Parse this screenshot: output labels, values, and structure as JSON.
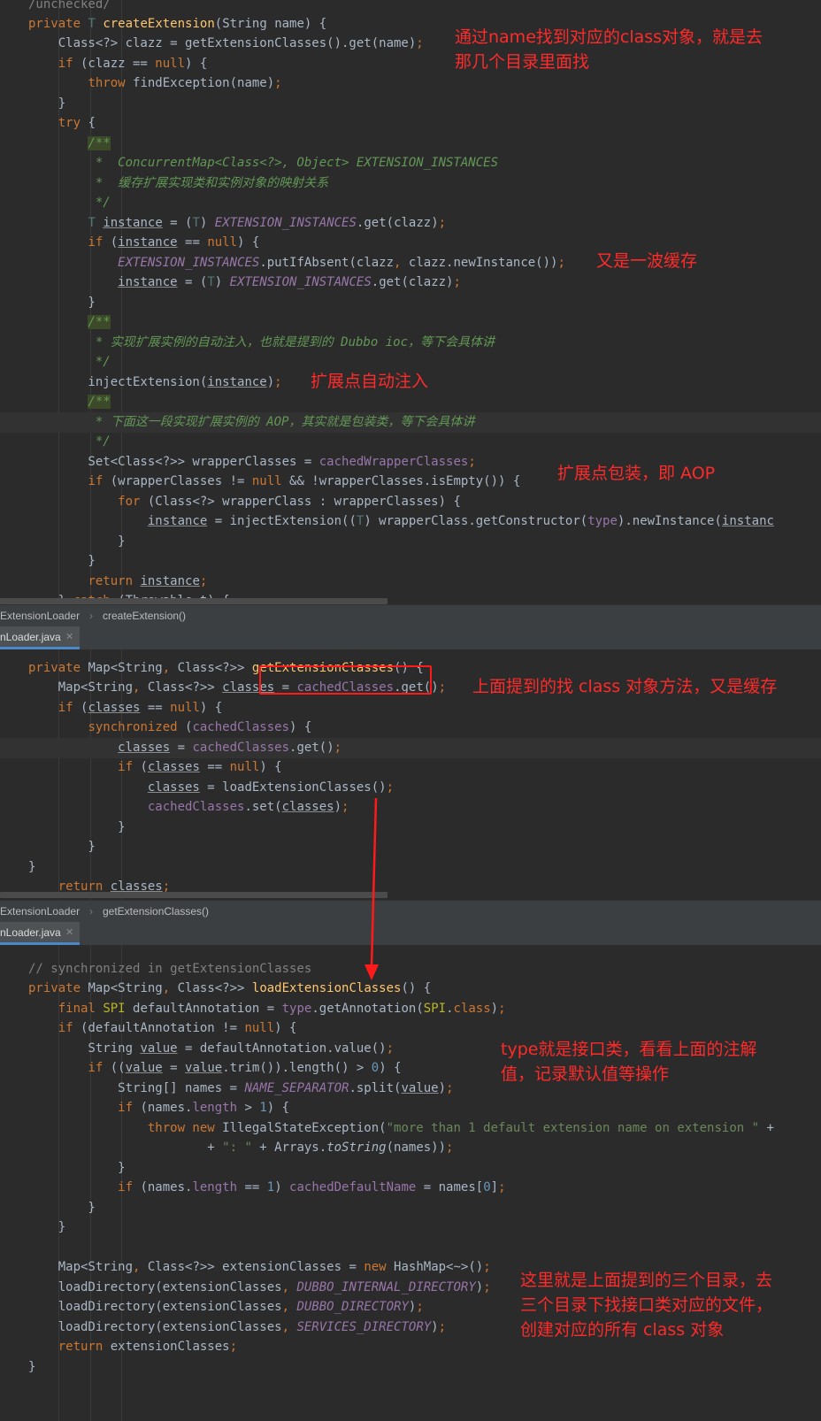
{
  "pane1": {
    "lines": [
      "/unchecked/",
      "private T createExtension(String name) {",
      "    Class<?> clazz = getExtensionClasses().get(name);",
      "    if (clazz == null) {",
      "        throw findException(name);",
      "    }",
      "    try {",
      "        /**",
      "         *  ConcurrentMap<Class<?>, Object> EXTENSION_INSTANCES",
      "         *  缓存扩展实现类和实例对象的映射关系",
      "         */",
      "        T instance = (T) EXTENSION_INSTANCES.get(clazz);",
      "        if (instance == null) {",
      "            EXTENSION_INSTANCES.putIfAbsent(clazz, clazz.newInstance());",
      "            instance = (T) EXTENSION_INSTANCES.get(clazz);",
      "        }",
      "        /**",
      "         * 实现扩展实例的自动注入，也就是提到的 Dubbo ioc，等下会具体讲",
      "         */",
      "        injectExtension(instance);",
      "        /**",
      "         * 下面这一段实现扩展实例的 AOP，其实就是包装类，等下会具体讲",
      "         */",
      "        Set<Class<?>> wrapperClasses = cachedWrapperClasses;",
      "        if (wrapperClasses != null && !wrapperClasses.isEmpty()) {",
      "            for (Class<?> wrapperClass : wrapperClasses) {",
      "                instance = injectExtension((T) wrapperClass.getConstructor(type).newInstance(instanc",
      "            }",
      "        }",
      "        return instance;",
      "    } catch (Throwable t) {"
    ]
  },
  "breadcrumb1": {
    "class": "ExtensionLoader",
    "method": "createExtension()"
  },
  "tab1": {
    "label": "nLoader.java",
    "close": "✕"
  },
  "pane2": {
    "lines": [
      "private Map<String, Class<?>> getExtensionClasses() {",
      "    Map<String, Class<?>> classes = cachedClasses.get();",
      "    if (classes == null) {",
      "        synchronized (cachedClasses) {",
      "            classes = cachedClasses.get();",
      "            if (classes == null) {",
      "                classes = loadExtensionClasses();",
      "                cachedClasses.set(classes);",
      "            }",
      "        }",
      "}",
      "    return classes;"
    ]
  },
  "breadcrumb2": {
    "class": "ExtensionLoader",
    "method": "getExtensionClasses()"
  },
  "tab2": {
    "label": "nLoader.java",
    "close": "✕"
  },
  "pane3": {
    "lines": [
      "// synchronized in getExtensionClasses",
      "private Map<String, Class<?>> loadExtensionClasses() {",
      "    final SPI defaultAnnotation = type.getAnnotation(SPI.class);",
      "    if (defaultAnnotation != null) {",
      "        String value = defaultAnnotation.value();",
      "        if ((value = value.trim()).length() > 0) {",
      "            String[] names = NAME_SEPARATOR.split(value);",
      "            if (names.length > 1) {",
      "                throw new IllegalStateException(\"more than 1 default extension name on extension \" +",
      "                        + \": \" + Arrays.toString(names));",
      "            }",
      "            if (names.length == 1) cachedDefaultName = names[0];",
      "        }",
      "    }",
      "",
      "    Map<String, Class<?>> extensionClasses = new HashMap<~>();",
      "    loadDirectory(extensionClasses, DUBBO_INTERNAL_DIRECTORY);",
      "    loadDirectory(extensionClasses, DUBBO_DIRECTORY);",
      "    loadDirectory(extensionClasses, SERVICES_DIRECTORY);",
      "    return extensionClasses;",
      "}"
    ]
  },
  "annotations": {
    "a1": "通过name找到对应的class对象，就是去那几个目录里面找",
    "a2": "又是一波缓存",
    "a3": "扩展点自动注入",
    "a4": "扩展点包装，即 AOP",
    "a5": "上面提到的找 class 对象方法，又是缓存",
    "a6": "type就是接口类，看看上面的注解值，记录默认值等操作",
    "a7": "这里就是上面提到的三个目录，去三个目录下找接口类对应的文件，创建对应的所有 class 对象"
  },
  "colors": {
    "annotation": "#ff2a2a",
    "background": "#2b2b2b",
    "keyword": "#cc7832",
    "method": "#ffc66d",
    "field": "#9876aa",
    "comment": "#629755"
  }
}
